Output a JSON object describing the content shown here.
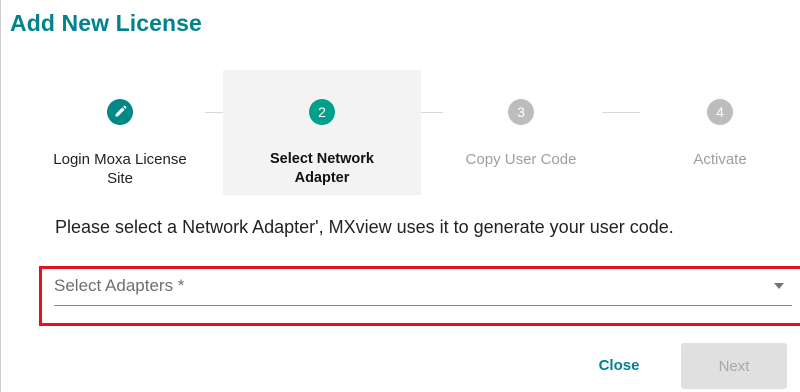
{
  "dialog": {
    "title": "Add New License"
  },
  "stepper": {
    "steps": [
      {
        "index": "1",
        "label_line1": "Login Moxa License",
        "label_line2": "Site",
        "state": "done",
        "icon": "pencil-icon"
      },
      {
        "index": "2",
        "label_line1": "Select Network",
        "label_line2": "Adapter",
        "state": "current"
      },
      {
        "index": "3",
        "label_line1": "Copy User Code",
        "label_line2": "",
        "state": "pending"
      },
      {
        "index": "4",
        "label_line1": "Activate",
        "label_line2": "",
        "state": "pending"
      }
    ]
  },
  "instruction": "Please select a Network Adapter', MXview uses it to generate your user code.",
  "adapter_select": {
    "placeholder": "Select Adapters *",
    "icon": "chevron-down-icon"
  },
  "actions": {
    "close_label": "Close",
    "next_label": "Next"
  },
  "colors": {
    "accent": "#00838f",
    "step_done": "#008787",
    "step_current": "#00a08a",
    "step_pending": "#bdbdbd",
    "highlight": "#e0141e"
  }
}
